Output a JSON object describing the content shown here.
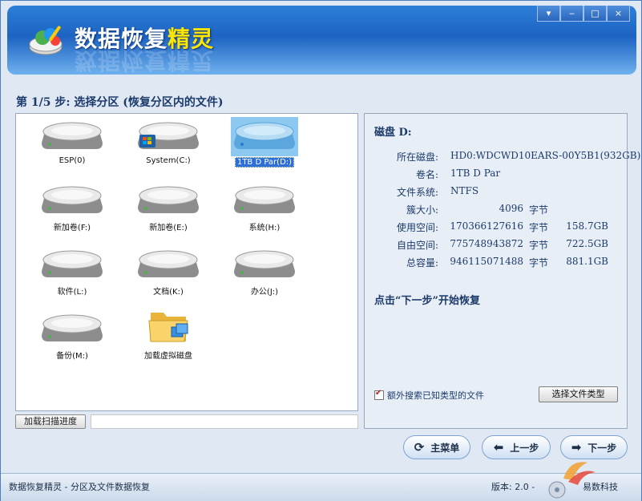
{
  "app": {
    "title_main": "数据恢复",
    "title_accent": "精灵"
  },
  "window_controls": [
    "▾",
    "‒",
    "□",
    "×"
  ],
  "step_title": "第 1/5 步: 选择分区 (恢复分区内的文件)",
  "drives": [
    {
      "label": "ESP(0)",
      "icon": "hard-disk-icon",
      "selected": false
    },
    {
      "label": "System(C:)",
      "icon": "system-disk-icon",
      "selected": false
    },
    {
      "label": "1TB D Par(D:)",
      "icon": "hard-disk-icon",
      "selected": true
    },
    {
      "label": "新加卷(F:)",
      "icon": "hard-disk-icon",
      "selected": false
    },
    {
      "label": "新加卷(E:)",
      "icon": "hard-disk-icon",
      "selected": false
    },
    {
      "label": "系统(H:)",
      "icon": "hard-disk-icon",
      "selected": false
    },
    {
      "label": "软件(L:)",
      "icon": "hard-disk-icon",
      "selected": false
    },
    {
      "label": "文档(K:)",
      "icon": "hard-disk-icon",
      "selected": false
    },
    {
      "label": "办公(J:)",
      "icon": "hard-disk-icon",
      "selected": false
    },
    {
      "label": "备份(M:)",
      "icon": "hard-disk-icon",
      "selected": false
    },
    {
      "label": "加载虚拟磁盘",
      "icon": "virtual-disk-folder-icon",
      "selected": false
    }
  ],
  "scan": {
    "load_progress_label": "加载扫描进度"
  },
  "disk_info": {
    "heading": "磁盘 D:",
    "rows": [
      {
        "key": "所在磁盘:",
        "value": "HD0:WDCWD10EARS-00Y5B1(932GB)"
      },
      {
        "key": "卷名:",
        "value": "1TB D Par"
      },
      {
        "key": "文件系统:",
        "value": "NTFS"
      },
      {
        "key": "簇大小:",
        "num": "4096",
        "unit": "字节",
        "gb": ""
      },
      {
        "key": "使用空间:",
        "num": "170366127616",
        "unit": "字节",
        "gb": "158.7GB"
      },
      {
        "key": "自由空间:",
        "num": "775748943872",
        "unit": "字节",
        "gb": "722.5GB"
      },
      {
        "key": "总容量:",
        "num": "946115071488",
        "unit": "字节",
        "gb": "881.1GB"
      }
    ],
    "hint": "点击“下一步”开始恢复",
    "extra_search_label": "额外搜索已知类型的文件",
    "extra_search_checked": true,
    "select_types_button": "选择文件类型"
  },
  "nav": {
    "main_menu": "主菜单",
    "prev": "上一步",
    "next": "下一步"
  },
  "status": {
    "left": "数据恢复精灵 - 分区及文件数据恢复",
    "version": "版本: 2.0 -",
    "company": "易数科技"
  },
  "colors": {
    "title_blue": "#1d63c2",
    "title_accent": "#ffe600",
    "selection": "#2d6fd6",
    "text_dark": "#1c3b6b",
    "checkbox_mark": "#c0141b"
  }
}
